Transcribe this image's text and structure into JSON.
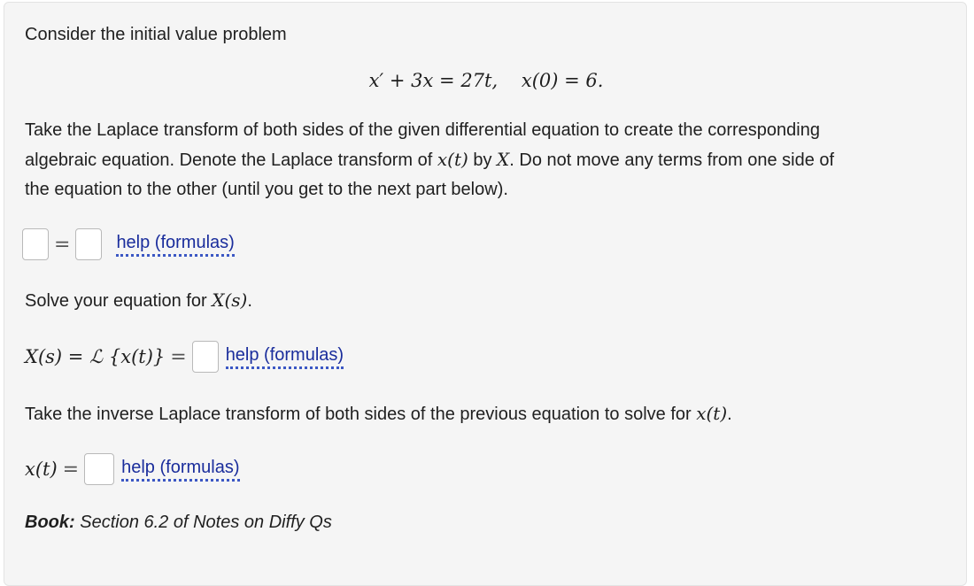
{
  "problem": {
    "intro": "Consider the initial value problem",
    "equation": {
      "lhs": "x′ + 3x",
      "equals": "=",
      "rhs": "27t,",
      "initial_condition": "x(0) = 6."
    },
    "part1_text_a": "Take the Laplace transform of both sides of the given differential equation to create the corresponding",
    "part1_text_b": "algebraic equation. Denote the Laplace transform of",
    "part1_math_xt": "x(t)",
    "part1_text_c": "by",
    "part1_math_X": "X",
    "part1_text_d": ". Do not move any terms from one side of",
    "part1_text_e": "the equation to the other (until you get to the next part below).",
    "part2_text": "Solve your equation for",
    "part2_math": "X(s)",
    "part2_period": ".",
    "part2_lhs": "X(s) = ℒ {x(t)}",
    "part3_text": "Take the inverse Laplace transform of both sides of the previous equation to solve for",
    "part3_math": "x(t)",
    "part3_period": ".",
    "part3_lhs": "x(t)",
    "equals_sign": "=",
    "help_label": "help (formulas)",
    "book_label": "Book:",
    "book_text": "Section 6.2 of Notes on Diffy Qs"
  },
  "colors": {
    "panel_background": "#f5f5f5",
    "link": "#1a2d9c"
  }
}
